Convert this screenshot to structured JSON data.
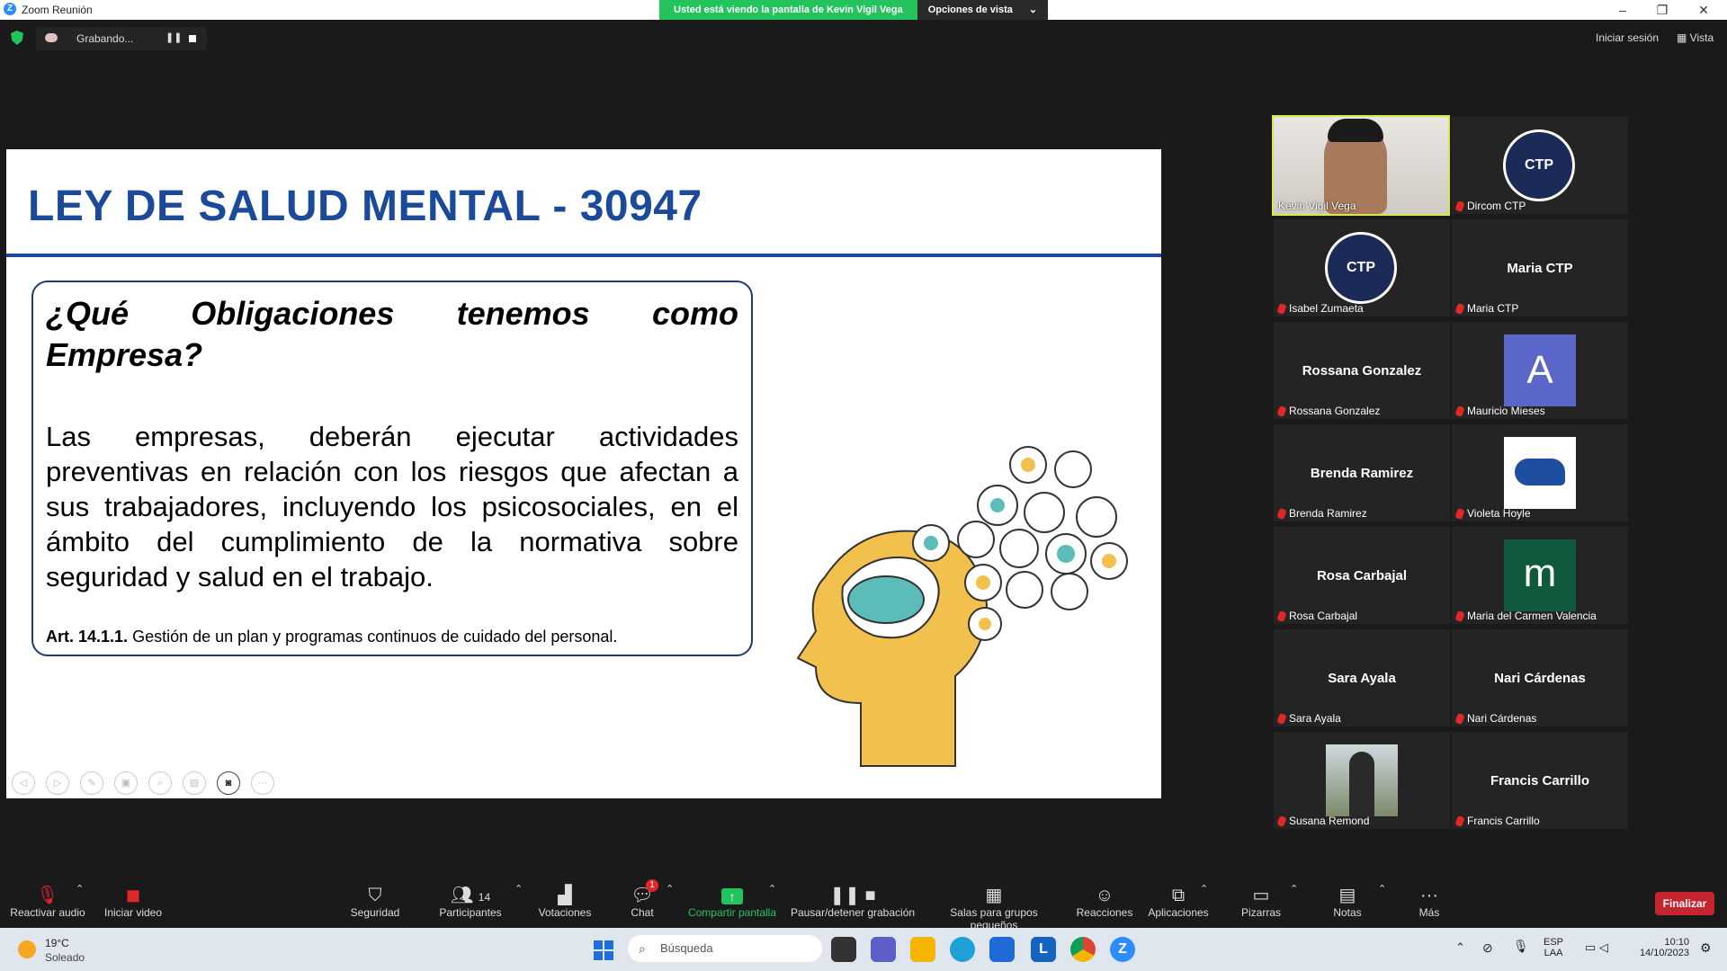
{
  "window": {
    "title": "Zoom Reunión"
  },
  "banner": {
    "text": "Usted está viendo la pantalla de Kevin Vigil Vega",
    "options": "Opciones de vista"
  },
  "recording": {
    "label": "Grabando..."
  },
  "top_right": {
    "signin": "Iniciar sesión",
    "view": "Vista"
  },
  "slide": {
    "title": "LEY DE SALUD MENTAL - 30947",
    "question": "¿Qué Obligaciones tenemos como Empresa?",
    "paragraph": "Las empresas, deberán ejecutar actividades preventivas en relación con los riesgos que afectan a sus trabajadores, incluyendo los psicosociales, en el ámbito del cumplimiento de la normativa sobre seguridad y salud en el trabajo.",
    "article_ref": "Art. 14.1.1.",
    "article_text": "Gestión de un plan y programas continuos de cuidado del personal."
  },
  "participants": [
    {
      "name": "Kevin Vigil Vega",
      "kind": "video"
    },
    {
      "name": "Dircom CTP",
      "kind": "logo"
    },
    {
      "name": "Isabel Zumaeta",
      "kind": "logo"
    },
    {
      "name": "Maria CTP",
      "display": "Maria CTP"
    },
    {
      "name": "Rossana Gonzalez",
      "display": "Rossana Gonzalez"
    },
    {
      "name": "Mauricio Mieses",
      "letter": "A"
    },
    {
      "name": "Brenda Ramirez",
      "display": "Brenda Ramirez"
    },
    {
      "name": "Violeta Hoyle",
      "kind": "bird"
    },
    {
      "name": "Rosa Carbajal",
      "display": "Rosa Carbajal"
    },
    {
      "name": "Maria del Carmen Valencia",
      "letter": "m"
    },
    {
      "name": "Sara Ayala",
      "display": "Sara Ayala"
    },
    {
      "name": "Nari Cárdenas",
      "display": "Nari Cárdenas"
    },
    {
      "name": "Susana Remond",
      "kind": "photo"
    },
    {
      "name": "Francis Carrillo",
      "display": "Francis Carrillo"
    }
  ],
  "toolbar": {
    "audio": "Reactivar audio",
    "video": "Iniciar video",
    "security": "Seguridad",
    "participants": "Participantes",
    "participants_count": "14",
    "polls": "Votaciones",
    "chat": "Chat",
    "chat_badge": "1",
    "share": "Compartir pantalla",
    "record": "Pausar/detener grabación",
    "breakout": "Salas para grupos pequeños",
    "reactions": "Reacciones",
    "apps": "Aplicaciones",
    "whiteboards": "Pizarras",
    "notes": "Notas",
    "more": "Más",
    "end": "Finalizar"
  },
  "taskbar": {
    "weather_temp": "19°C",
    "weather_desc": "Soleado",
    "search": "Búsqueda",
    "lang1": "ESP",
    "lang2": "LAA",
    "time": "10:10",
    "date": "14/10/2023"
  },
  "colors": {
    "slide_title": "#1b4a9a",
    "banner": "#23c45e",
    "finalizar": "#c6252f",
    "active_speaker": "#d8e84a"
  }
}
